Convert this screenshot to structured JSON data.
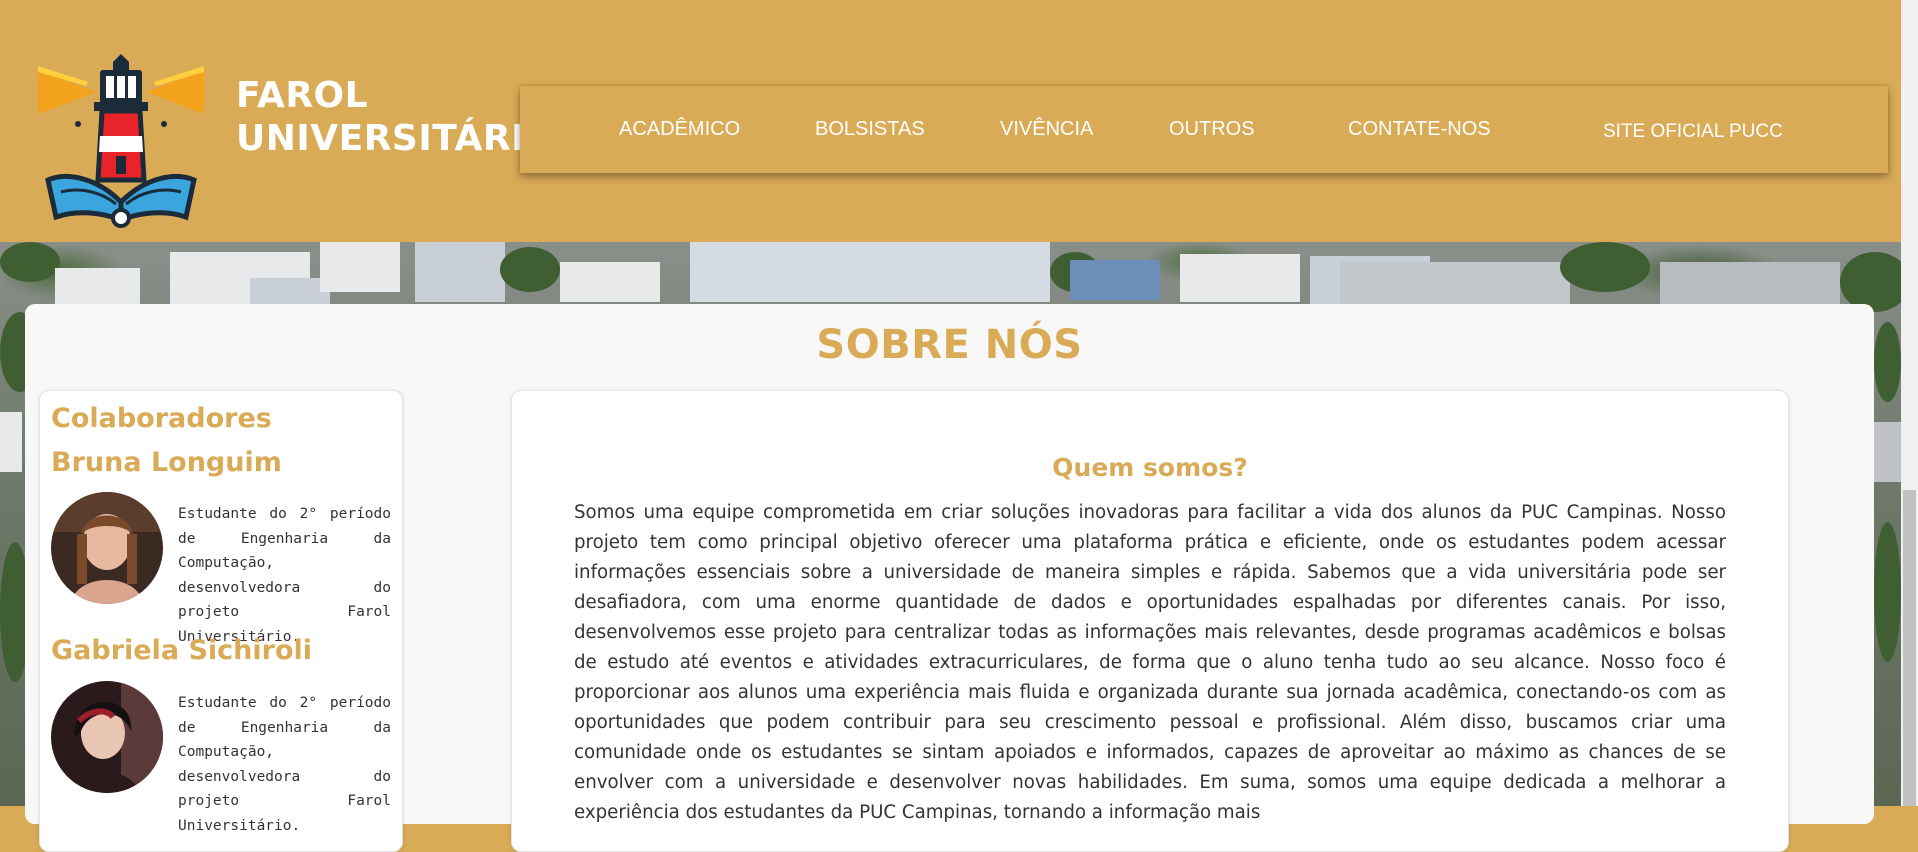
{
  "brand": {
    "line1": "FAROL",
    "line2": "UNIVERSITÁRIO"
  },
  "nav": {
    "items": [
      {
        "label": "ACADÊMICO"
      },
      {
        "label": "BOLSISTAS"
      },
      {
        "label": "VIVÊNCIA"
      },
      {
        "label": "OUTROS"
      },
      {
        "label": "CONTATE-NOS"
      },
      {
        "label": "SITE OFICIAL PUCC"
      }
    ]
  },
  "page": {
    "title": "SOBRE NÓS"
  },
  "sidebar": {
    "heading": "Colaboradores",
    "people": [
      {
        "name": "Bruna Longuim",
        "bio": "Estudante do 2° período de Engenharia da Computação, desenvolvedora do projeto Farol Universitário."
      },
      {
        "name": "Gabriela Sichiroli",
        "bio": "Estudante do 2° período de Engenharia da Computação, desenvolvedora do projeto Farol Universitário."
      }
    ]
  },
  "content": {
    "subtitle": "Quem somos?",
    "text": "Somos uma equipe comprometida em criar soluções inovadoras para facilitar a vida dos alunos da PUC Campinas. Nosso projeto tem como principal objetivo oferecer uma plataforma prática e eficiente, onde os estudantes podem acessar informações essenciais sobre a universidade de maneira simples e rápida. Sabemos que a vida universitária pode ser desafiadora, com uma enorme quantidade de dados e oportunidades espalhadas por diferentes canais. Por isso, desenvolvemos esse projeto para centralizar todas as informações mais relevantes, desde programas acadêmicos e bolsas de estudo até eventos e atividades extracurriculares, de forma que o aluno tenha tudo ao seu alcance. Nosso foco é proporcionar aos alunos uma experiência mais fluida e organizada durante sua jornada acadêmica, conectando-os com as oportunidades que podem contribuir para seu crescimento pessoal e profissional. Além disso, buscamos criar uma comunidade onde os estudantes se sintam apoiados e informados, capazes de aproveitar ao máximo as chances de se envolver com a universidade e desenvolver novas habilidades. Em suma, somos uma equipe dedicada a melhorar a experiência dos estudantes da PUC Campinas, tornando a informação mais"
  },
  "colors": {
    "accent": "#d9ab56",
    "card": "#f8f8f8",
    "text": "#333333"
  }
}
